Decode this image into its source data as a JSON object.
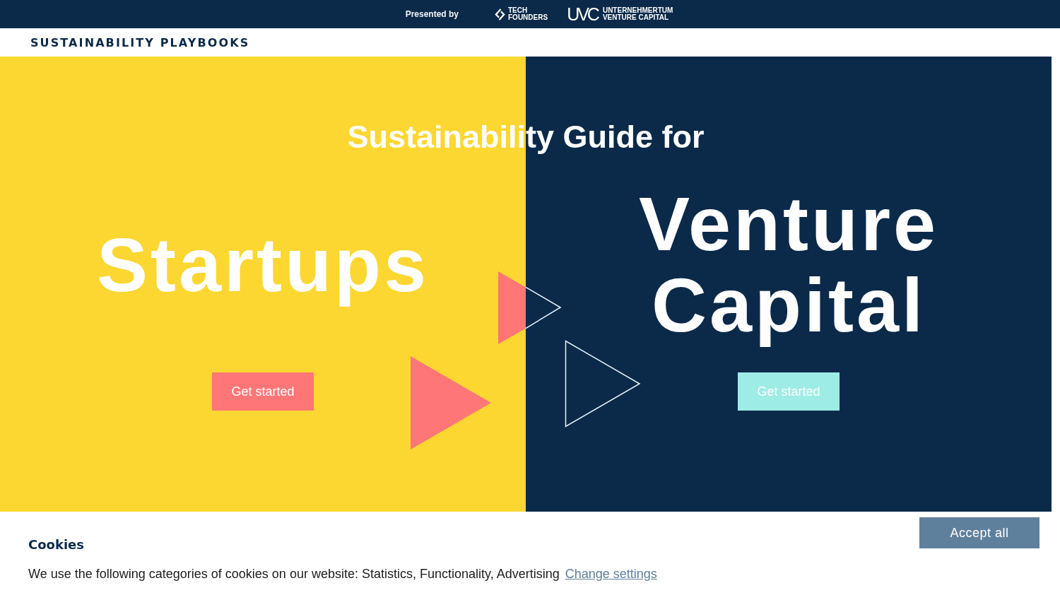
{
  "top_bar": {
    "presented_by": "Presented by",
    "sponsors": [
      {
        "kind": "icon-logo",
        "lines": [
          "TECH",
          "FOUNDERS"
        ]
      },
      {
        "kind": "monogram-logo",
        "monogram": "UVC",
        "lines": [
          "UNTERNEHMERTUM",
          "VENTURE CAPITAL"
        ]
      }
    ]
  },
  "nav": {
    "title": "SUSTAINABILITY PLAYBOOKS"
  },
  "hero": {
    "title": "Sustainability Guide for",
    "panels": [
      {
        "heading": "Startups",
        "button": "Get started"
      },
      {
        "heading": "Venture Capital",
        "button": "Get started"
      }
    ]
  },
  "cookie_banner": {
    "title": "Cookies",
    "text": "We use the following categories of cookies on our website: Statistics, Functionality, Advertising",
    "link": "Change settings",
    "button": "Accept all"
  }
}
